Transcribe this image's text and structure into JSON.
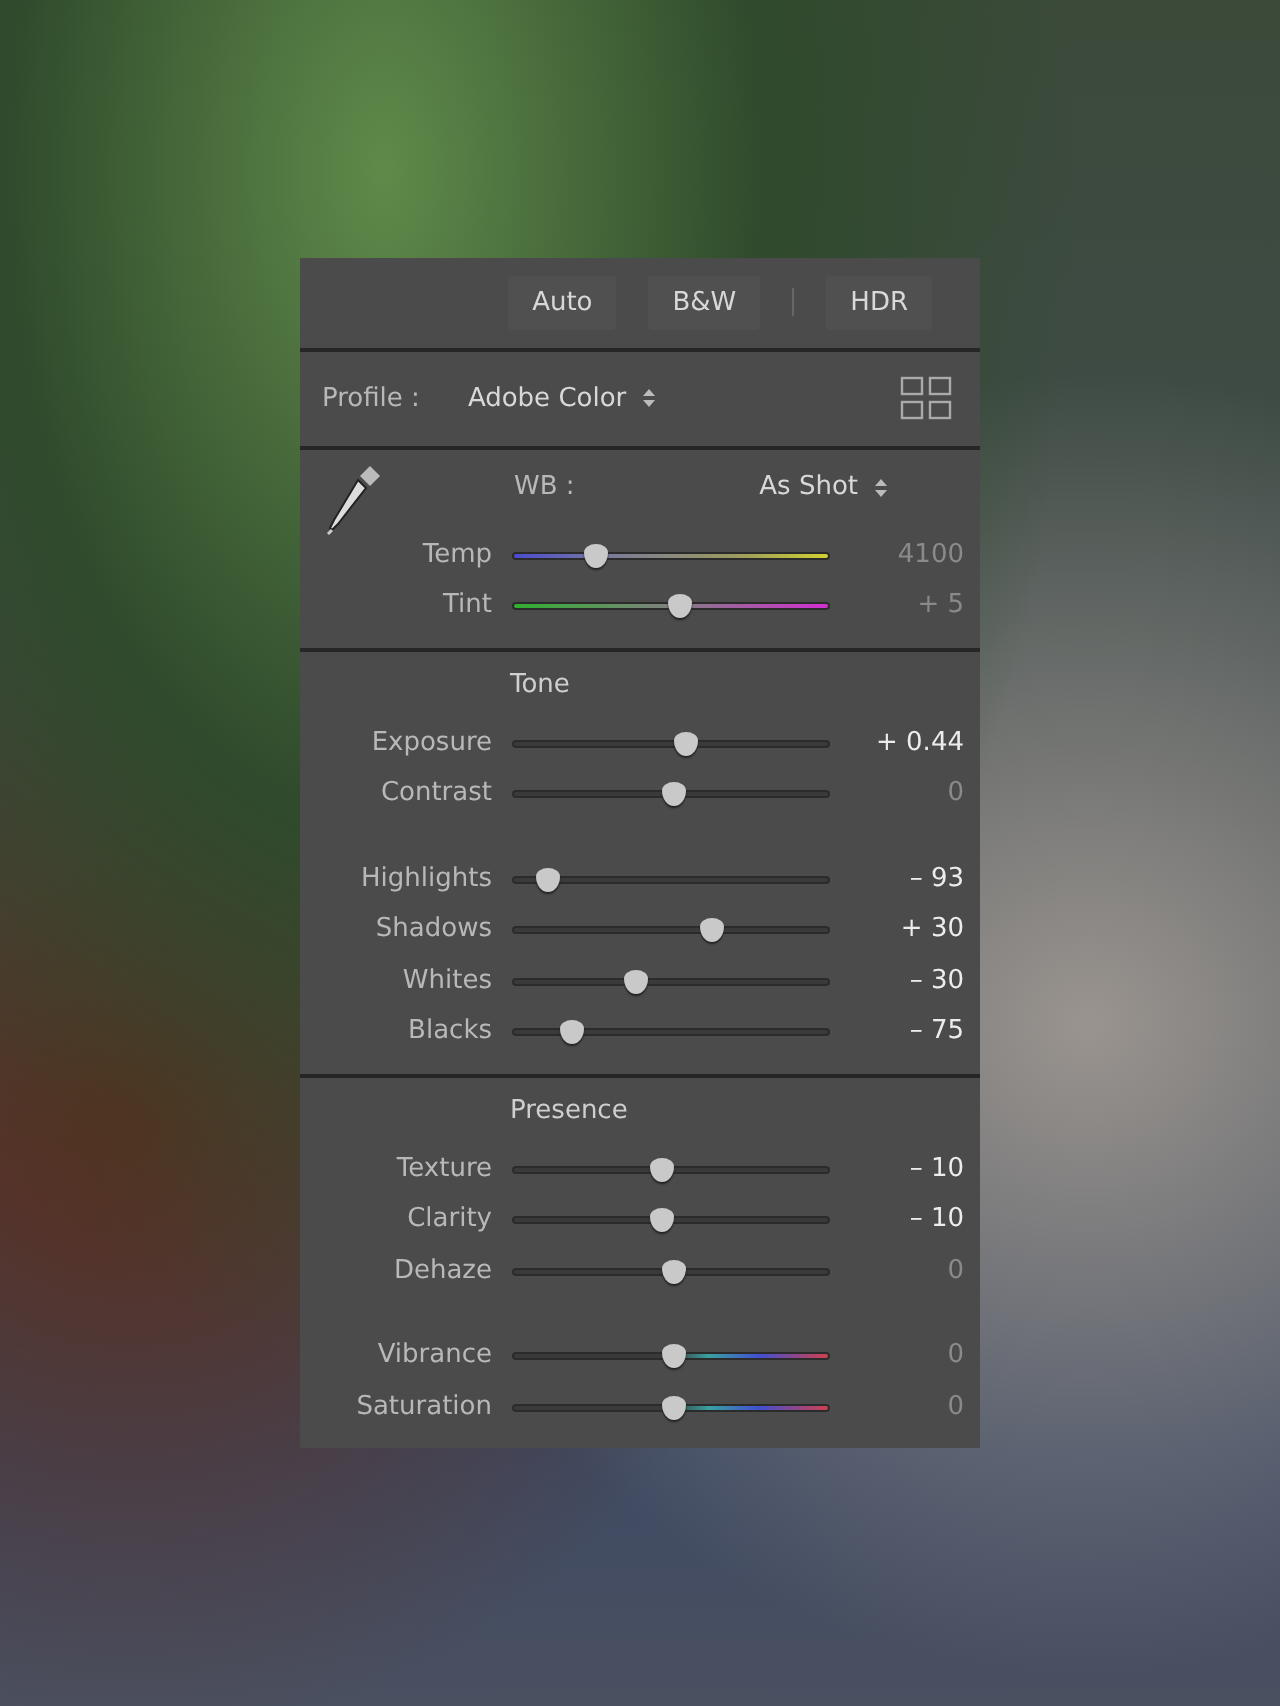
{
  "top_buttons": [
    {
      "label": "Auto"
    },
    {
      "label": "B&W"
    },
    {
      "label": "HDR"
    }
  ],
  "profile": {
    "label": "Profile :",
    "value": "Adobe Color"
  },
  "white_balance": {
    "label": "WB :",
    "value": "As Shot",
    "sliders": [
      {
        "label": "Temp",
        "kind": "temp",
        "level": 0.245,
        "reading": "4100",
        "emphasized": false
      },
      {
        "label": "Tint",
        "kind": "tint",
        "level": 0.53,
        "reading": "+ 5",
        "emphasized": false
      }
    ]
  },
  "sections": [
    {
      "title": "Tone",
      "groups": [
        [
          {
            "label": "Exposure",
            "kind": "plain",
            "level": 0.55,
            "reading": "+ 0.44",
            "emphasized": true
          },
          {
            "label": "Contrast",
            "kind": "plain",
            "level": 0.51,
            "reading": "0",
            "emphasized": false
          }
        ],
        [
          {
            "label": "Highlights",
            "kind": "plain",
            "level": 0.08,
            "reading": "– 93",
            "emphasized": true
          },
          {
            "label": "Shadows",
            "kind": "plain",
            "level": 0.64,
            "reading": "+ 30",
            "emphasized": true
          },
          {
            "label": "Whites",
            "kind": "plain",
            "level": 0.38,
            "reading": "– 30",
            "emphasized": true
          },
          {
            "label": "Blacks",
            "kind": "plain",
            "level": 0.16,
            "reading": "– 75",
            "emphasized": true
          }
        ]
      ]
    },
    {
      "title": "Presence",
      "groups": [
        [
          {
            "label": "Texture",
            "kind": "plain",
            "level": 0.47,
            "reading": "– 10",
            "emphasized": true
          },
          {
            "label": "Clarity",
            "kind": "plain",
            "level": 0.47,
            "reading": "– 10",
            "emphasized": true
          },
          {
            "label": "Dehaze",
            "kind": "plain",
            "level": 0.51,
            "reading": "0",
            "emphasized": false
          }
        ],
        [
          {
            "label": "Vibrance",
            "kind": "color",
            "level": 0.51,
            "reading": "0",
            "emphasized": false
          },
          {
            "label": "Saturation",
            "kind": "color",
            "level": 0.51,
            "reading": "0",
            "emphasized": false
          }
        ]
      ]
    }
  ]
}
